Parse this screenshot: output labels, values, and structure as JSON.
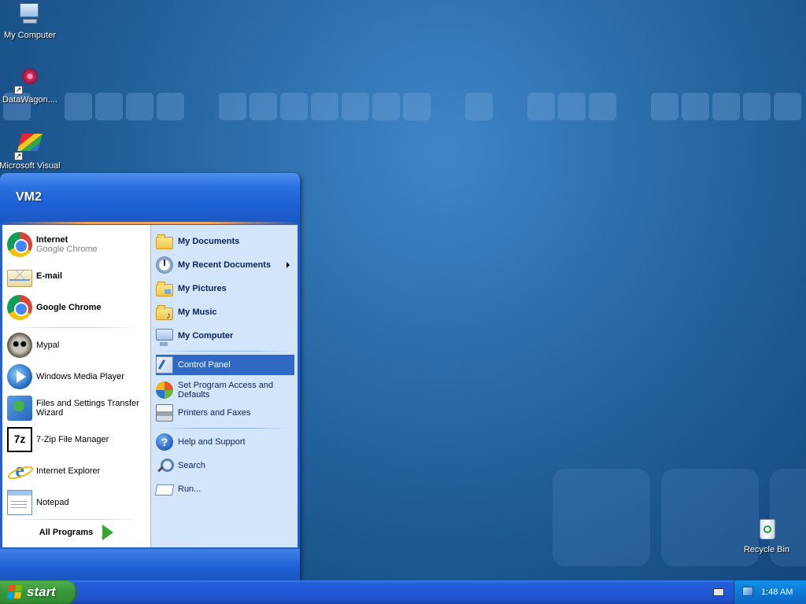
{
  "desktop": {
    "icons": [
      {
        "label": "My Computer",
        "icon": "my-computer-icon"
      },
      {
        "label": "DataWagon....",
        "icon": "datawagon-icon"
      },
      {
        "label": "Microsoft Visual",
        "icon": "visual-studio-icon"
      },
      {
        "label": "Recycle Bin",
        "icon": "recycle-bin-icon"
      }
    ]
  },
  "start_menu": {
    "user": "VM2",
    "pinned": [
      {
        "title": "Internet",
        "subtitle": "Google Chrome",
        "icon": "chrome-icon"
      },
      {
        "title": "E-mail",
        "icon": "email-icon"
      }
    ],
    "recent": [
      {
        "title": "Google Chrome",
        "icon": "chrome-icon"
      },
      {
        "title": "Mypal",
        "icon": "mypal-icon"
      },
      {
        "title": "Windows Media Player",
        "icon": "media-player-icon"
      },
      {
        "title": "Files and Settings Transfer",
        "title2": "Wizard",
        "icon": "transfer-wizard-icon"
      },
      {
        "title": "7-Zip File Manager",
        "icon": "7zip-icon"
      },
      {
        "title": "Internet Explorer",
        "icon": "ie-icon"
      },
      {
        "title": "Notepad",
        "icon": "notepad-icon"
      }
    ],
    "all_programs": "All Programs",
    "places": [
      {
        "label": "My Documents",
        "icon": "my-documents-icon"
      },
      {
        "label": "My Recent Documents",
        "icon": "recent-documents-icon"
      },
      {
        "label": "My Pictures",
        "icon": "my-pictures-icon"
      },
      {
        "label": "My Music",
        "icon": "my-music-icon"
      },
      {
        "label": "My Computer",
        "icon": "my-computer-icon"
      }
    ],
    "settings": [
      {
        "label": "Control Panel",
        "icon": "control-panel-icon",
        "selected": true
      },
      {
        "label": "Set Program Access and",
        "label2": "Defaults",
        "icon": "program-access-icon"
      },
      {
        "label": "Printers and Faxes",
        "icon": "printer-icon"
      }
    ],
    "tools": [
      {
        "label": "Help and Support",
        "icon": "help-icon"
      },
      {
        "label": "Search",
        "icon": "search-icon"
      },
      {
        "label": "Run...",
        "icon": "run-icon"
      }
    ]
  },
  "taskbar": {
    "start_label": "start",
    "clock": "1:48 AM"
  },
  "colors": {
    "selection": "#316ac5",
    "taskbar": "#245edb",
    "start_button": "#3c9c3c"
  }
}
